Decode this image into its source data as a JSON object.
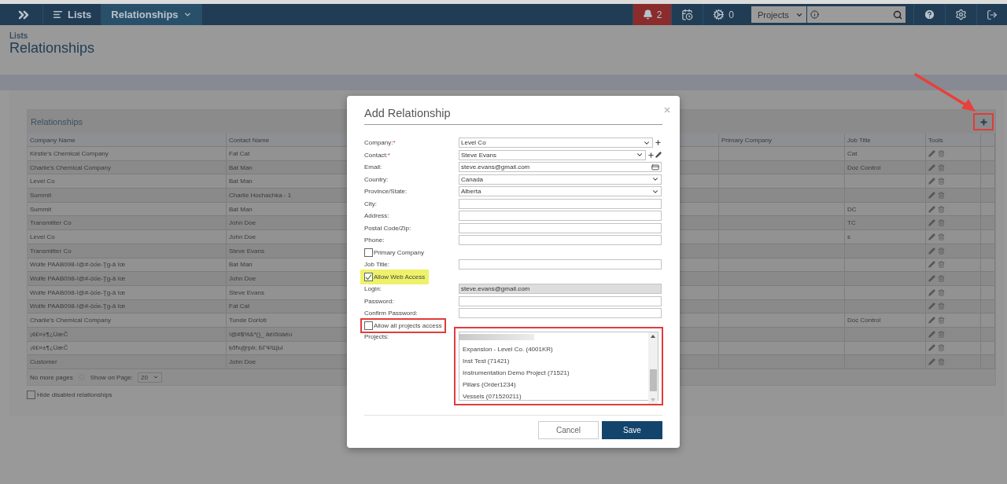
{
  "nav": {
    "breadcrumbs": [
      {
        "label": "Lists"
      },
      {
        "label": "Relationships"
      }
    ],
    "notifications": "2",
    "tasks": "0",
    "scope": "Projects"
  },
  "page": {
    "parent": "Lists",
    "title": "Relationships"
  },
  "table": {
    "title": "Relationships",
    "add_framed": true,
    "columns": [
      "Company Name",
      "Contact Name",
      "Primary Company",
      "Job Title",
      "Tools"
    ],
    "rows": [
      {
        "company": "Kirstie's Chemical Company",
        "contact": "Fat Cat",
        "job_title": "Cat"
      },
      {
        "company": "Charlie's Chemical Company",
        "contact": "Bat Man",
        "job_title": "Doc Control"
      },
      {
        "company": "Level Co",
        "contact": "Bat Man"
      },
      {
        "company": "Summit",
        "contact": "Charlie Hochachka - 1"
      },
      {
        "company": "Summit",
        "contact": "Bat Man",
        "job_title": "DC"
      },
      {
        "company": "Transmitter Co",
        "contact": "John Doe",
        "job_title": "TC"
      },
      {
        "company": "Level Co",
        "contact": "John Doe",
        "job_title": "s"
      },
      {
        "company": "Transmitter Co",
        "contact": "Steve Evans"
      },
      {
        "company": "Wolfe PAAB098-!@#-ộốe-Ţg-â ïœ",
        "contact": "Bat Man"
      },
      {
        "company": "Wolfe PAAB098-!@#-ộốe-Ţg-â ïœ",
        "contact": "John Doe"
      },
      {
        "company": "Wolfe PAAB098-!@#-ộốe-Ţg-â ïœ",
        "contact": "Steve Evans"
      },
      {
        "company": "Wolfe PAAB098-!@#-ộốe-Ţg-â ïœ",
        "contact": "Fat Cat"
      },
      {
        "company": "Charlie's Chemical Company",
        "contact": "Tunde Dorloti",
        "job_title": "Doc Control"
      },
      {
        "company": "¡¢£¤±¶¿ÜæČ",
        "contact": "!@#$%&*()_ äéîõûàèù"
      },
      {
        "company": "¡¢£¤±¶¿ÜæČ",
        "contact": "ķőħųļĵŗşŵ; БГΨЩЫ"
      },
      {
        "company": "Customer",
        "contact": "John Doe"
      }
    ],
    "pager": {
      "status": "No more pages",
      "show_label": "Show on Page:",
      "page_size": "20"
    },
    "hide_disabled": {
      "label": "Hide disabled relationships",
      "checked": false
    }
  },
  "modal": {
    "title": "Add Relationship",
    "fields": [
      {
        "kind": "select",
        "label": "Company:",
        "required_mark": "*",
        "value": "Level Co",
        "addable": true,
        "editable": false,
        "card": false
      },
      {
        "kind": "select",
        "label": "Contact:",
        "required_mark": "*",
        "value": "Steve Evans",
        "addable": true,
        "editable": true,
        "card": false
      },
      {
        "kind": "input",
        "label": "Email:",
        "value": "steve.evans@gmail.com",
        "addable": false,
        "editable": false,
        "card": true
      },
      {
        "kind": "select",
        "label": "Country:",
        "value": "Canada",
        "addable": false,
        "editable": false,
        "card": false
      },
      {
        "kind": "select",
        "label": "Province/State:",
        "value": "Alberta",
        "addable": false,
        "editable": false,
        "card": false
      },
      {
        "kind": "input",
        "label": "City:",
        "addable": false,
        "editable": false,
        "card": false
      },
      {
        "kind": "input",
        "label": "Address:",
        "addable": false,
        "editable": false,
        "card": false
      },
      {
        "kind": "input",
        "label": "Postal Code/Zip:",
        "addable": false,
        "editable": false,
        "card": false
      },
      {
        "kind": "input",
        "label": "Phone:",
        "addable": false,
        "editable": false,
        "card": false
      },
      {
        "kind": "checkbox",
        "label": "Primary Company",
        "checked": false,
        "highlighted": false,
        "framed": false
      },
      {
        "kind": "input",
        "label": "Job Title:",
        "addable": false,
        "editable": false,
        "card": false
      },
      {
        "kind": "checkbox",
        "label": "Allow Web Access",
        "checked": true,
        "highlighted": true,
        "framed": false
      },
      {
        "kind": "readonly",
        "label": "Login:",
        "value": "steve.evans@gmail.com",
        "addable": false,
        "editable": false,
        "card": false
      },
      {
        "kind": "input",
        "label": "Password:",
        "addable": false,
        "editable": false,
        "card": false
      },
      {
        "kind": "input",
        "label": "Confirm Password:",
        "addable": false,
        "editable": false,
        "card": false
      },
      {
        "kind": "checkbox",
        "label": "Allow all projects access",
        "checked": false,
        "highlighted": false,
        "framed": true
      },
      {
        "kind": "list",
        "label": "Projects:",
        "framed": true,
        "items": [
          {
            "kind": "redacted"
          },
          {
            "kind": "option",
            "label": "Expansion - Level Co. (4001KR)"
          },
          {
            "kind": "option",
            "label": "Inst Test (71421)"
          },
          {
            "kind": "option",
            "label": "Instrumentation Demo Project (71521)"
          },
          {
            "kind": "option",
            "label": "Pillars (Order1234)"
          },
          {
            "kind": "option",
            "label": "Vessels (071520211)"
          }
        ]
      }
    ],
    "buttons": [
      {
        "kind": "secondary",
        "label": "Cancel"
      },
      {
        "kind": "primary",
        "label": "Save"
      }
    ]
  },
  "annotations": [
    {
      "kind": "arrow"
    }
  ]
}
